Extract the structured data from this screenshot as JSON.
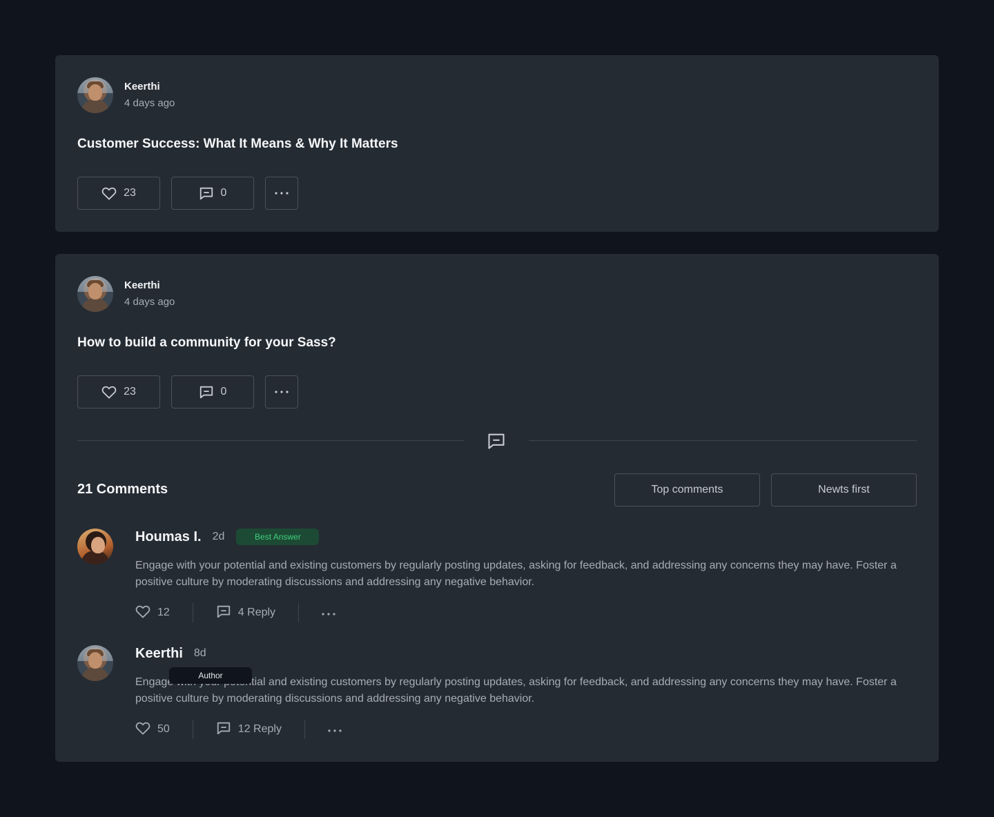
{
  "posts": [
    {
      "author": "Keerthi",
      "time": "4 days ago",
      "title": "Customer Success: What It Means & Why It Matters",
      "likes": "23",
      "comments": "0"
    },
    {
      "author": "Keerthi",
      "time": "4 days ago",
      "title": "How to build a community for your Sass?",
      "likes": "23",
      "comments": "0"
    }
  ],
  "comments_section": {
    "count_label": "21 Comments",
    "sort_top": "Top comments",
    "sort_newest": "Newts first",
    "items": [
      {
        "name": "Houmas I.",
        "time": "2d",
        "badge": "Best Answer",
        "text": "Engage with your potential and existing customers by regularly posting updates, asking for feedback, and addressing any concerns they may have. Foster a positive culture by moderating discussions and addressing any negative behavior.",
        "likes": "12",
        "replies": "4 Reply"
      },
      {
        "name": "Keerthi",
        "time": "8d",
        "badge": "Author",
        "text": "Engage with your potential and existing customers by regularly posting updates, asking for feedback, and addressing any concerns they may have. Foster a positive culture by moderating discussions and addressing any negative behavior.",
        "likes": "50",
        "replies": "12 Reply"
      }
    ]
  },
  "colors": {
    "page_bg": "#0f141d",
    "card_bg": "#252b33",
    "best_answer_bg": "#1d4a35",
    "best_answer_text": "#3fcf7c"
  },
  "icons": [
    "heart-icon",
    "comment-icon",
    "more-icon"
  ]
}
